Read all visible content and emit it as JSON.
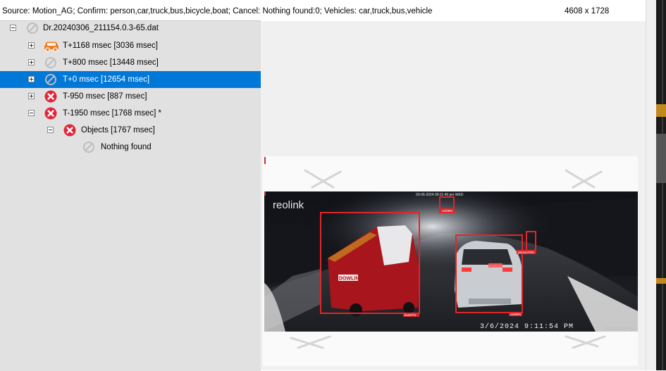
{
  "status_bar": {
    "source_line": "Source: Motion_AG; Confirm: person,car,truck,bus,bicycle,boat; Cancel: Nothing found:0; Vehicles: car,truck,bus,vehicle",
    "image_size": "4608 x 1728"
  },
  "tree": {
    "root": {
      "label": "Dr.20240306_211154.0.3-65.dat",
      "icon": "no-detection-icon"
    },
    "children": [
      {
        "label": "T+1168 msec  [3036 msec]",
        "icon": "car-icon"
      },
      {
        "label": "T+800 msec  [13448 msec]",
        "icon": "no-detection-icon"
      },
      {
        "label": "T+0 msec  [12654 msec]",
        "icon": "no-detection-icon",
        "selected": true
      },
      {
        "label": "T-950 msec  [887 msec]",
        "icon": "cancel-icon"
      },
      {
        "label": "T-1950 msec  [1768 msec]  *",
        "icon": "cancel-icon"
      }
    ],
    "sub": {
      "label": "Objects [1767 msec]",
      "icon": "cancel-icon"
    },
    "leaf": {
      "label": "Nothing found",
      "icon": "no-detection-icon"
    }
  },
  "camera": {
    "brand": "reolink",
    "top_timestamp": "03-06-2024 09:11:49 pm WED",
    "bottom_timestamp": "3/6/2024  9:11:54 PM",
    "watermark": "Sat Coverage Cam",
    "detections": [
      {
        "label": "car68%"
      },
      {
        "label": "bus87%"
      },
      {
        "label": "car69%"
      },
      {
        "label": "person78%"
      }
    ],
    "van_brand": "DOWLING"
  },
  "colors": {
    "tree_bg": "#e1e1e1",
    "selection": "#0078d7",
    "detection_box": "#e0262a",
    "car_icon": "#ef7d23",
    "cancel_icon": "#e0263a",
    "no_detection_icon": "#bdbdbd"
  }
}
